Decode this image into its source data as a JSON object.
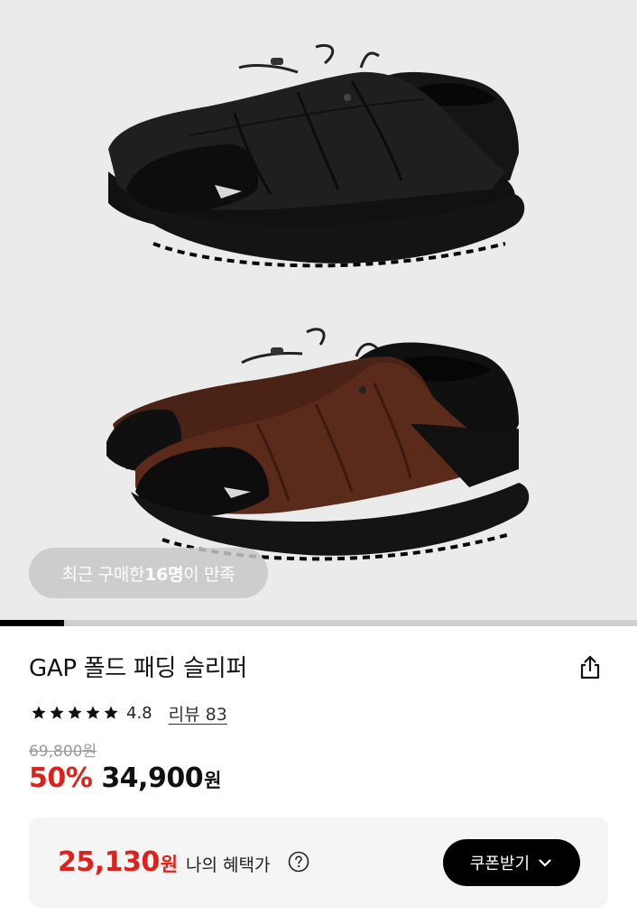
{
  "gallery": {
    "social_proof": {
      "prefix": "최근 구매한 ",
      "highlight": "16명",
      "suffix": "이 만족"
    },
    "progress_fraction": 0.1
  },
  "product": {
    "title": "GAP 폴드 패딩 슬리퍼",
    "rating": {
      "stars": 5,
      "value": "4.8",
      "review_label": "리뷰 83"
    },
    "original_price": "69,800원",
    "discount": "50%",
    "price": "34,900",
    "price_unit": "원"
  },
  "benefit": {
    "amount": "25,130",
    "unit": "원",
    "label": "나의 혜택가",
    "coupon_button": "쿠폰받기"
  },
  "colors": {
    "accent_red": "#e0201b",
    "button_black": "#000000"
  },
  "icons": [
    "share-icon",
    "star-icon",
    "question-circle-icon",
    "chevron-down-icon"
  ]
}
